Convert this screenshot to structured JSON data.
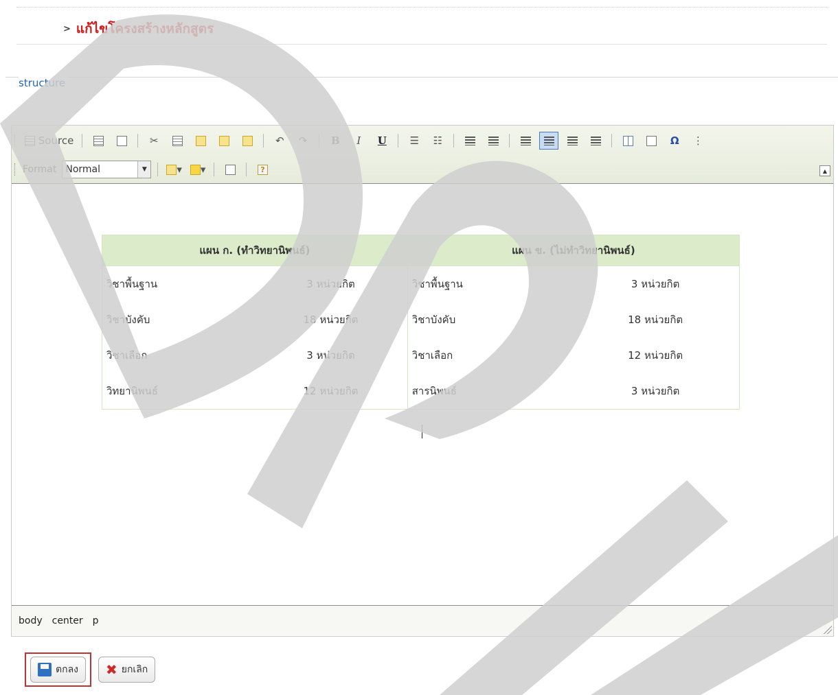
{
  "page": {
    "title": "แก้ไขโครงสร้างหลักสูตร",
    "arrow": ">"
  },
  "fieldset": {
    "legend": "structure"
  },
  "toolbar": {
    "source_label": "Source",
    "format_label": "Format",
    "format_value": "Normal"
  },
  "table": {
    "headers": [
      "แผน ก. (ทำวิทยานิพนธ์)",
      "แผน ข. (ไม่ทำวิทยานิพนธ์)"
    ],
    "rows": [
      [
        "วิชาพื้นฐาน",
        "3 หน่วยกิต",
        "วิชาพื้นฐาน",
        "3 หน่วยกิต"
      ],
      [
        "วิชาบังคับ",
        "18 หน่วยกิต",
        "วิชาบังคับ",
        "18 หน่วยกิต"
      ],
      [
        "วิชาเลือก",
        "3 หน่วยกิต",
        "วิชาเลือก",
        "12 หน่วยกิต"
      ],
      [
        "วิทยานิพนธ์",
        "12 หน่วยกิต",
        "สารนิพนธ์",
        "3 หน่วยกิต"
      ]
    ]
  },
  "pathbar": {
    "items": [
      "body",
      "center",
      "p"
    ]
  },
  "buttons": {
    "ok": "ตกลง",
    "cancel": "ยกเลิก"
  },
  "colors": {
    "heading": "#d41a1a",
    "legend": "#2466b7",
    "header_bg": "#dceccb",
    "watermark": "#d6d6d6"
  },
  "watermark": {
    "letters": "DP"
  }
}
